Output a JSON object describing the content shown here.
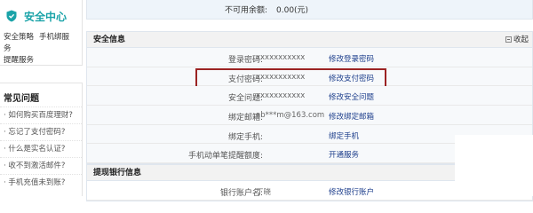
{
  "sidebar": {
    "security_center": "安全中心",
    "links": [
      "安全策略",
      "手机绑服务",
      "提醒服务"
    ],
    "faq_title": "常见问题",
    "faq": [
      "· 如何购买百度理财?",
      "· 忘记了支付密码?",
      "· 什么是实名认证?",
      "· 收不到激活邮件?",
      "· 手机充值未到账?"
    ]
  },
  "balance": {
    "label": "不可用余额:",
    "value": "0.00(元)"
  },
  "security": {
    "title": "安全信息",
    "collapse": "收起",
    "rows": [
      {
        "label": "登录密码:",
        "value": "xxxxxxxxxxx",
        "action": "修改登录密码"
      },
      {
        "label": "支付密码:",
        "value": "xxxxxxxxxxx",
        "action": "修改支付密码"
      },
      {
        "label": "安全问题:",
        "value": "xxxxxxxxxxx",
        "action": "修改安全问题"
      },
      {
        "label": "绑定邮箱:",
        "value": "ab***m@163.com",
        "action": "修改绑定邮箱"
      },
      {
        "label": "绑定手机:",
        "value": "-",
        "action": "绑定手机"
      },
      {
        "label": "手机动单笔提醒额度:",
        "value": "-",
        "action": "开通服务"
      }
    ]
  },
  "bank": {
    "title": "提现银行信息",
    "rows": [
      {
        "label": "银行账户名:",
        "value": "丁晓",
        "action": "修改银行账户"
      }
    ]
  }
}
